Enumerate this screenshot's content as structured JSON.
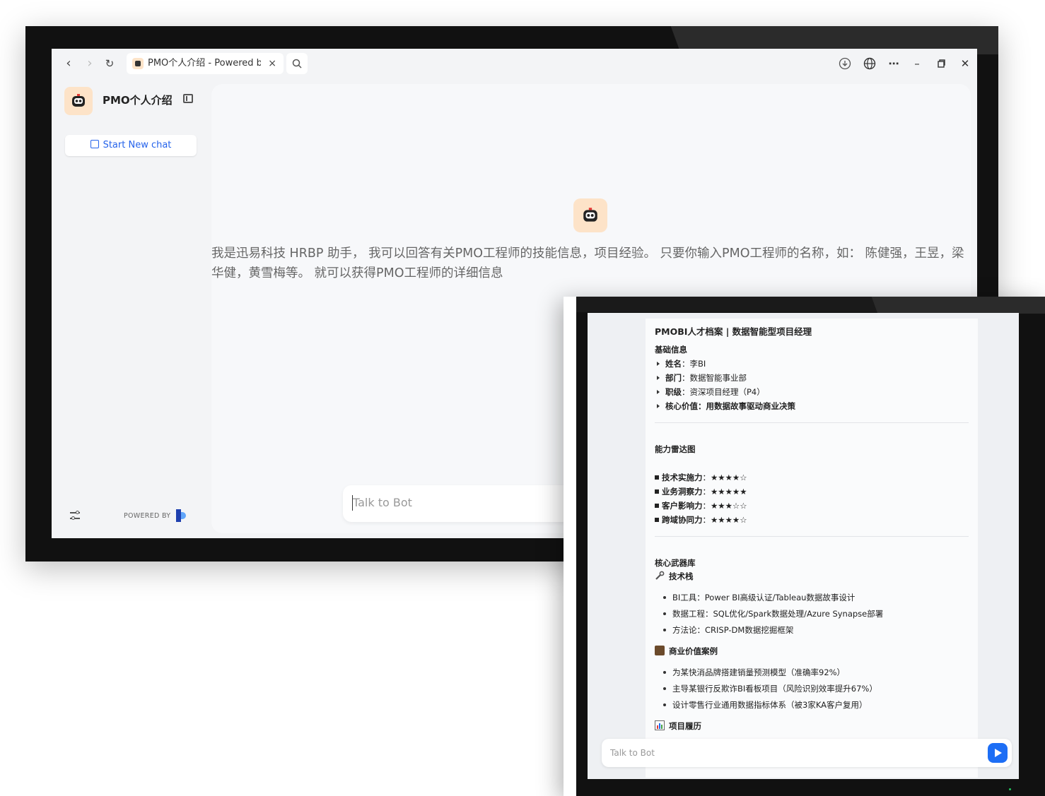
{
  "browser": {
    "tab_title": "PMO个人介绍 - Powered by",
    "tab_close": "×"
  },
  "sidebar": {
    "app_name": "PMO个人介绍",
    "new_chat_label": "Start New chat",
    "powered_by": "POWERED BY"
  },
  "main": {
    "welcome": "我是迅易科技 HRBP 助手， 我可以回答有关PMO工程师的技能信息，项目经验。 只要你输入PMO工程师的名称，如： 陈健强，王昱，梁华健，黄雪梅等。 就可以获得PMO工程师的详细信息",
    "input_placeholder": "Talk to Bot"
  },
  "doc": {
    "title": "PMOBI人才档案 | 数据智能型项目经理",
    "basic": {
      "heading": "基础信息",
      "items": [
        {
          "k": "姓名",
          "v": "：李BI"
        },
        {
          "k": "部门",
          "v": "：数据智能事业部"
        },
        {
          "k": "职级",
          "v": "：资深项目经理（P4）"
        },
        {
          "k": "核心价值",
          "v": "：用数据故事驱动商业决策"
        }
      ]
    },
    "radar": {
      "heading": "能力雷达图",
      "items": [
        {
          "k": "技术实施力",
          "v": "：★★★★☆"
        },
        {
          "k": "业务洞察力",
          "v": "：★★★★★"
        },
        {
          "k": "客户影响力",
          "v": "：★★★☆☆"
        },
        {
          "k": "跨域协同力",
          "v": "：★★★★☆"
        }
      ]
    },
    "arsenal": {
      "heading": "核心武器库",
      "tech_heading": "技术栈",
      "tech": [
        "BI工具：Power BI高级认证/Tableau数据故事设计",
        "数据工程：SQL优化/Spark数据处理/Azure Synapse部署",
        "方法论：CRISP-DM数据挖掘框架"
      ],
      "cases_heading": "商业价值案例",
      "cases": [
        "为某快消品牌搭建销量预测模型（准确率92%）",
        "主导某银行反欺诈BI看板项目（风险识别效率提升67%）",
        "设计零售行业通用数据指标体系（被3家KA客户复用）"
      ],
      "history_heading": "项目履历"
    },
    "input_placeholder": "Talk to Bot"
  },
  "colors": {
    "accent": "#2563eb",
    "send": "#1d6ef5",
    "avatar_bg": "#fde3c8"
  }
}
